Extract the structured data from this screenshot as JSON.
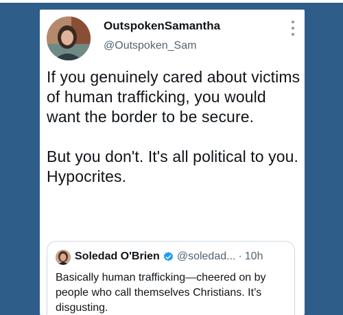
{
  "tweet": {
    "display_name": "OutspokenSamantha",
    "handle": "@Outspoken_Sam",
    "paragraphs": [
      "If you genuinely cared about victims of human trafficking, you would want the border to be secure.",
      "But you don't. It's all political to you. Hypocrites."
    ],
    "more_icon": "more-options-icon"
  },
  "quote": {
    "display_name": "Soledad O'Brien",
    "handle": "@soledad...",
    "separator": "·",
    "time": "10h",
    "text": "Basically human trafficking—cheered on by people who call themselves Christians. It’s disgusting.",
    "verified_icon": "verified-badge-icon"
  },
  "colors": {
    "background": "#2e5d8a",
    "card": "#ffffff",
    "text_primary": "#0f1419",
    "text_secondary": "#536471",
    "verified": "#1d9bf0",
    "border": "#cfd9de"
  }
}
